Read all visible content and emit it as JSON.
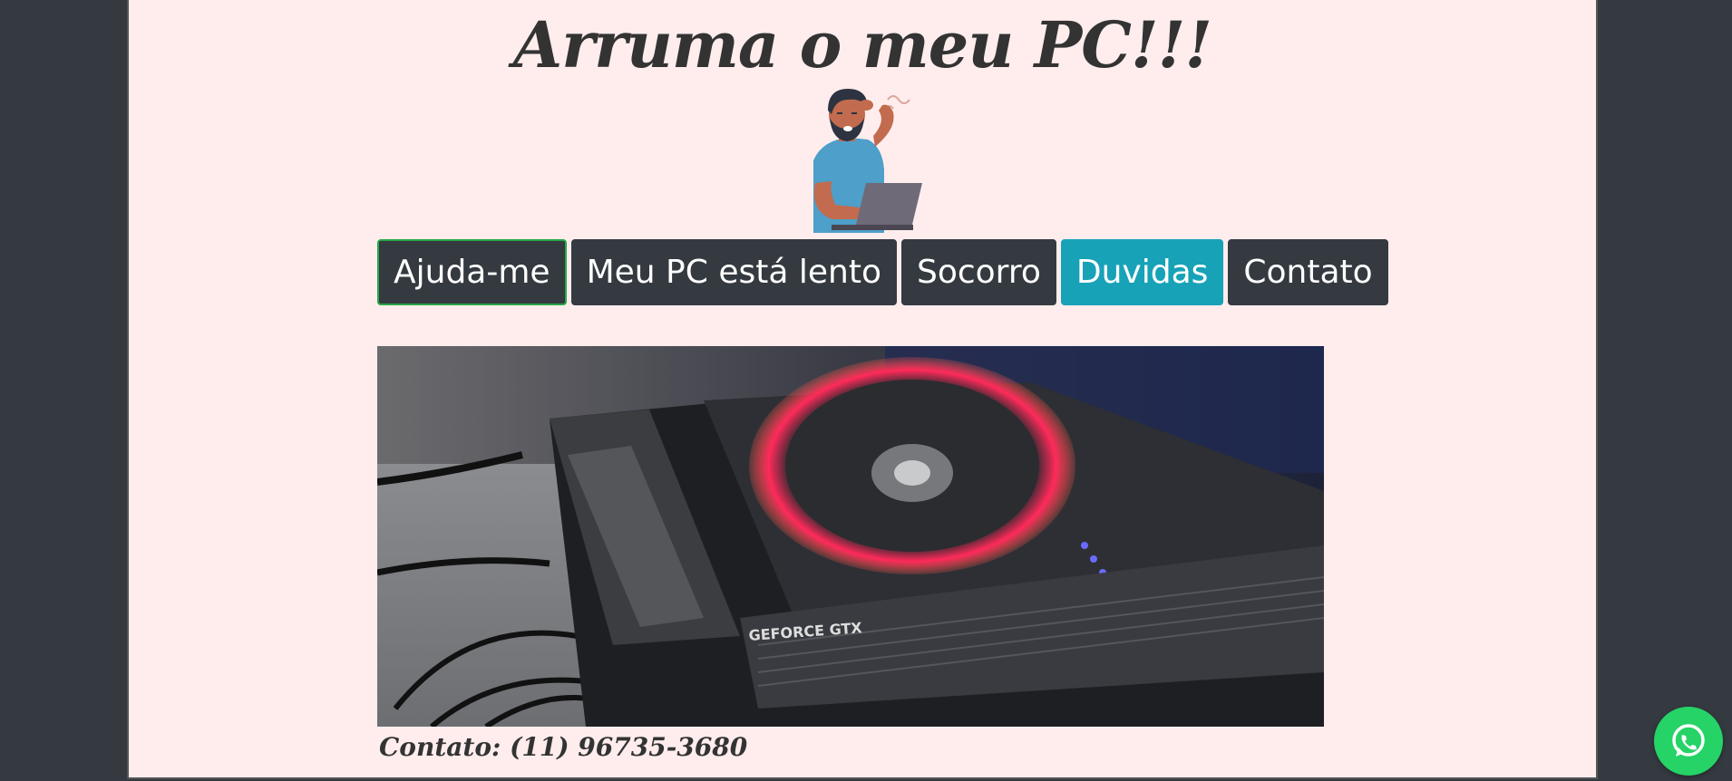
{
  "header": {
    "title": "Arruma o meu PC!!!"
  },
  "illustration": {
    "icon": "stressed-man-laptop-icon"
  },
  "nav": {
    "items": [
      {
        "label": "Ajuda-me"
      },
      {
        "label": "Meu PC está lento"
      },
      {
        "label": "Socorro"
      },
      {
        "label": "Duvidas"
      },
      {
        "label": "Contato"
      }
    ]
  },
  "hero": {
    "icon": "graphics-card-photo",
    "card_text": "GEFORCE GTX"
  },
  "footer": {
    "contact": "Contato: (11) 96735-3680"
  },
  "whatsapp": {
    "icon": "whatsapp-icon"
  },
  "colors": {
    "background": "#343a40",
    "page": "#ffeded",
    "button_dark": "#343a40",
    "button_info": "#17a2b8",
    "active_border": "#28a745",
    "whatsapp": "#25d366"
  }
}
